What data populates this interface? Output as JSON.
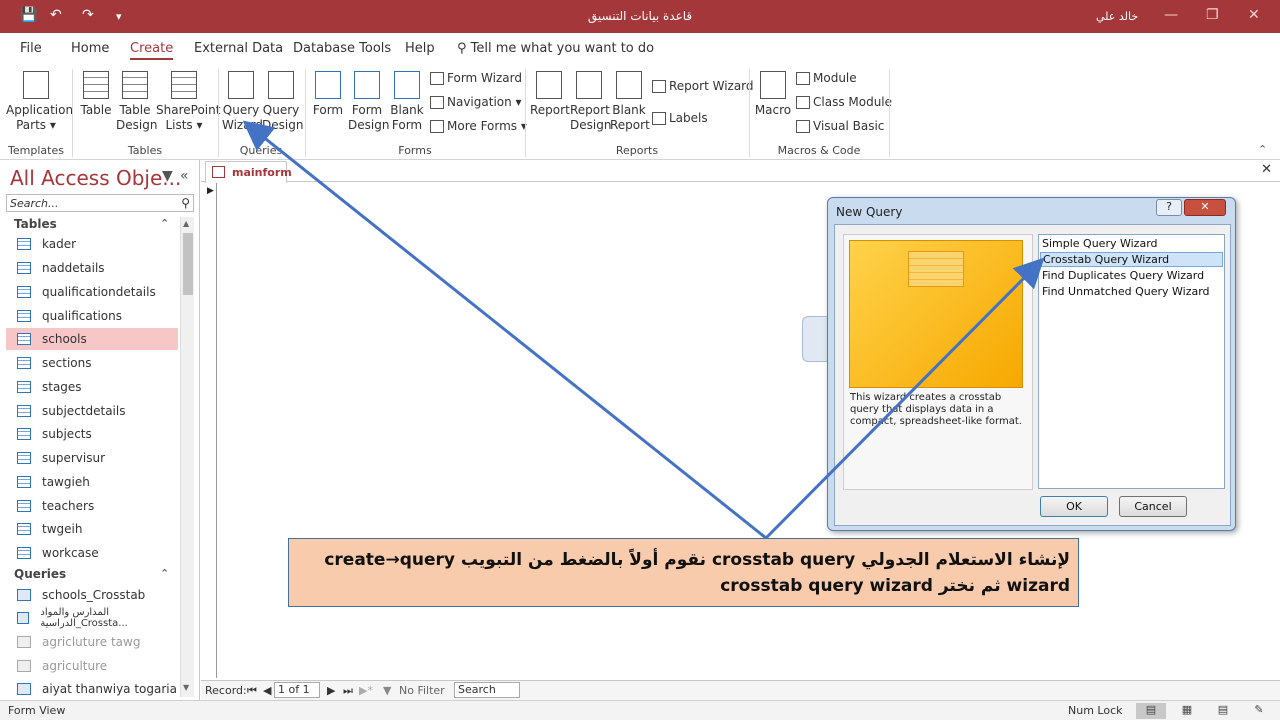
{
  "titlebar": {
    "save_icon": "save-icon",
    "undo_icon": "undo-icon",
    "redo_icon": "redo-icon",
    "title": "قاعدة بيانات التنسيق",
    "user": "خالد علي"
  },
  "menu": {
    "tabs": [
      "File",
      "Home",
      "Create",
      "External Data",
      "Database Tools",
      "Help"
    ],
    "active": "Create",
    "tell_me": "Tell me what you want to do"
  },
  "ribbon": {
    "templates": {
      "app_parts_1": "Application",
      "app_parts_2": "Parts ▾",
      "group": "Templates"
    },
    "tables": {
      "table": "Table",
      "table_design_1": "Table",
      "table_design_2": "Design",
      "sharepoint_1": "SharePoint",
      "sharepoint_2": "Lists ▾",
      "group": "Tables"
    },
    "queries": {
      "wizard_1": "Query",
      "wizard_2": "Wizard",
      "design_1": "Query",
      "design_2": "Design",
      "group": "Queries"
    },
    "forms": {
      "form": "Form",
      "form_design_1": "Form",
      "form_design_2": "Design",
      "blank_form_1": "Blank",
      "blank_form_2": "Form",
      "form_wizard": "Form Wizard",
      "navigation": "Navigation ▾",
      "more_forms": "More Forms ▾",
      "group": "Forms"
    },
    "reports": {
      "report": "Report",
      "report_design_1": "Report",
      "report_design_2": "Design",
      "blank_report_1": "Blank",
      "blank_report_2": "Report",
      "report_wizard": "Report Wizard",
      "labels": "Labels",
      "group": "Reports"
    },
    "macros": {
      "macro": "Macro",
      "module": "Module",
      "class_module": "Class Module",
      "visual_basic": "Visual Basic",
      "group": "Macros & Code"
    }
  },
  "nav": {
    "title": "All Access Obje...",
    "search_placeholder": "Search...",
    "tables_header": "Tables",
    "tables": [
      "kader",
      "naddetails",
      "qualificationdetails",
      "qualifications",
      "schools",
      "sections",
      "stages",
      "subjectdetails",
      "subjects",
      "supervisur",
      "tawgieh",
      "teachers",
      "twgeih",
      "workcase"
    ],
    "selected_table": "schools",
    "queries_header": "Queries",
    "queries": [
      "schools_Crosstab",
      "المدارس والمواد الدراسية_Crossta...",
      "agricluture tawg",
      "agriculture",
      "aiyat thanwiya togaria"
    ]
  },
  "document": {
    "tab_label": "mainform",
    "record_label": "Record:",
    "record_value": "1 of 1",
    "filter_label": "No Filter",
    "search_label": "Search"
  },
  "statusbar": {
    "left": "Form View",
    "numlock": "Num Lock"
  },
  "dialog": {
    "title": "New Query",
    "help": "?",
    "close": "✕",
    "description": "This wizard creates a crosstab query that displays data in a compact, spreadsheet-like format.",
    "options": [
      "Simple Query Wizard",
      "Crosstab Query Wizard",
      "Find Duplicates Query Wizard",
      "Find Unmatched Query Wizard"
    ],
    "selected": "Crosstab Query Wizard",
    "ok": "OK",
    "cancel": "Cancel"
  },
  "annotation": {
    "line1": "لإنشاء الاستعلام الجدولي crosstab query نقوم أولاً بالضغط من التبويب create→query",
    "line2": "wizard ثم نختر crosstab query wizard"
  },
  "colors": {
    "accent": "#a4373a",
    "annotation_bg": "#f8cbad",
    "arrow": "#4472c4"
  }
}
